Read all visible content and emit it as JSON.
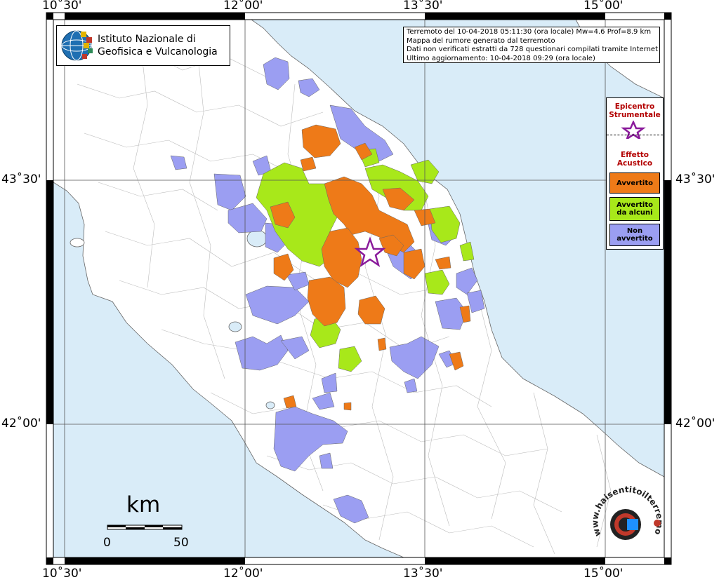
{
  "logo": {
    "line1": "Istituto Nazionale di",
    "line2": "Geofisica e Vulcanologia"
  },
  "info": {
    "line1": "Terremoto del 10-04-2018 05:11:30 (ora locale) Mw=4.6 Prof=8.9 km",
    "line2": "Mappa del rumore generato dal terremoto",
    "line3": "Dati non verificati estratti da 728 questionari compilati tramite Internet",
    "line4": "Ultimo aggiornamento: 10-04-2018 09:29 (ora locale)"
  },
  "axis": {
    "lon_top": [
      "10˚30'",
      "12˚00'",
      "13˚30'",
      "15˚00'"
    ],
    "lon_bottom": [
      "10˚30'",
      "12˚00'",
      "13˚30'",
      "15˚00'"
    ],
    "lat_left": [
      "43˚30'",
      "42˚00'"
    ],
    "lat_right": [
      "43˚30'",
      "42˚00'"
    ]
  },
  "legend": {
    "epicentro_title_1": "Epicentro",
    "epicentro_title_2": "Strumentale",
    "effetto_title_1": "Effetto",
    "effetto_title_2": "Acustico",
    "avvertito": "Avvertito",
    "avvertito_alcuni_1": "Avvertito",
    "avvertito_alcuni_2": "da alcuni",
    "non_avvertito_1": "Non",
    "non_avvertito_2": "avvertito"
  },
  "colors": {
    "sea": "#d9ecf8",
    "land": "#ffffff",
    "avvertito": "#ee7a18",
    "avvertito_alcuni": "#a8e81a",
    "non_avvertito": "#9b9ef2",
    "epicenter_star": "#8a1a9b",
    "legend_title": "#b30000"
  },
  "scale": {
    "unit": "km",
    "start": "0",
    "end": "50"
  },
  "watermark": {
    "text": "www.haisentitoilterremoto.it"
  }
}
